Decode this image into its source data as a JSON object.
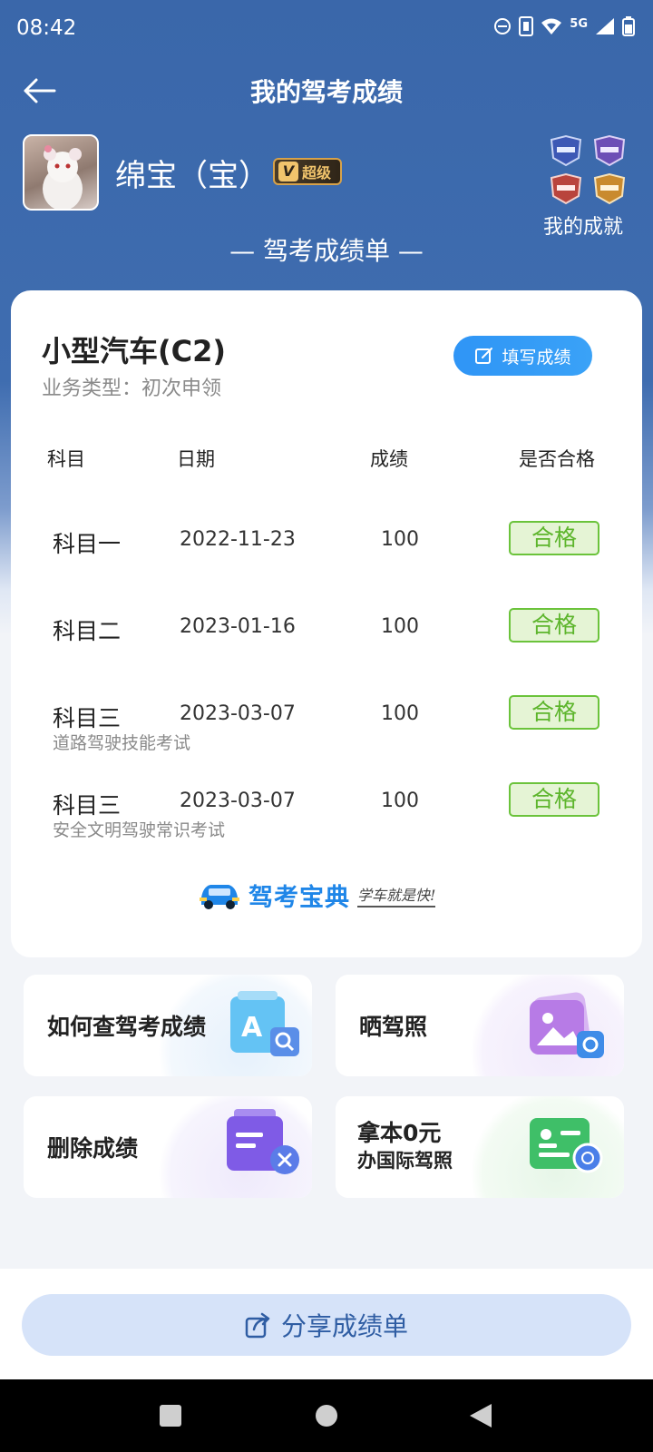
{
  "status_bar": {
    "time": "08:42",
    "network": "5G",
    "icons": [
      "dnd-icon",
      "sim-icon",
      "wifi-icon",
      "signal-icon",
      "battery-icon"
    ]
  },
  "nav": {
    "title": "我的驾考成绩",
    "back_icon": "arrow-left-icon"
  },
  "profile": {
    "username": "绵宝（宝）",
    "vip_letter": "V",
    "vip_label": "超级"
  },
  "achievements": {
    "label": "我的成就"
  },
  "sheet_title": "— 驾考成绩单 —",
  "card": {
    "vehicle": "小型汽车(C2)",
    "business_type": "业务类型：初次申领",
    "fill_button": "填写成绩",
    "headers": {
      "subject": "科目",
      "date": "日期",
      "score": "成绩",
      "pass": "是否合格"
    },
    "rows": [
      {
        "subject": "科目一",
        "sub": "",
        "date": "2022-11-23",
        "score": "100",
        "pass": "合格"
      },
      {
        "subject": "科目二",
        "sub": "",
        "date": "2023-01-16",
        "score": "100",
        "pass": "合格"
      },
      {
        "subject": "科目三",
        "sub": "道路驾驶技能考试",
        "date": "2023-03-07",
        "score": "100",
        "pass": "合格"
      },
      {
        "subject": "科目三",
        "sub": "安全文明驾驶常识考试",
        "date": "2023-03-07",
        "score": "100",
        "pass": "合格"
      }
    ],
    "brand_name": "驾考宝典",
    "brand_slogan": "学车就是快!"
  },
  "tiles": {
    "check_score": "如何查驾考成绩",
    "show_license": "晒驾照",
    "delete_score": "删除成绩",
    "intl_line1": "拿本0元",
    "intl_line2": "办国际驾照"
  },
  "share_button": "分享成绩单",
  "colors": {
    "header_blue": "#3f6db0",
    "pass_green": "#6bc33b",
    "button_blue": "#2f95f6",
    "share_bg": "#d6e3f9"
  }
}
